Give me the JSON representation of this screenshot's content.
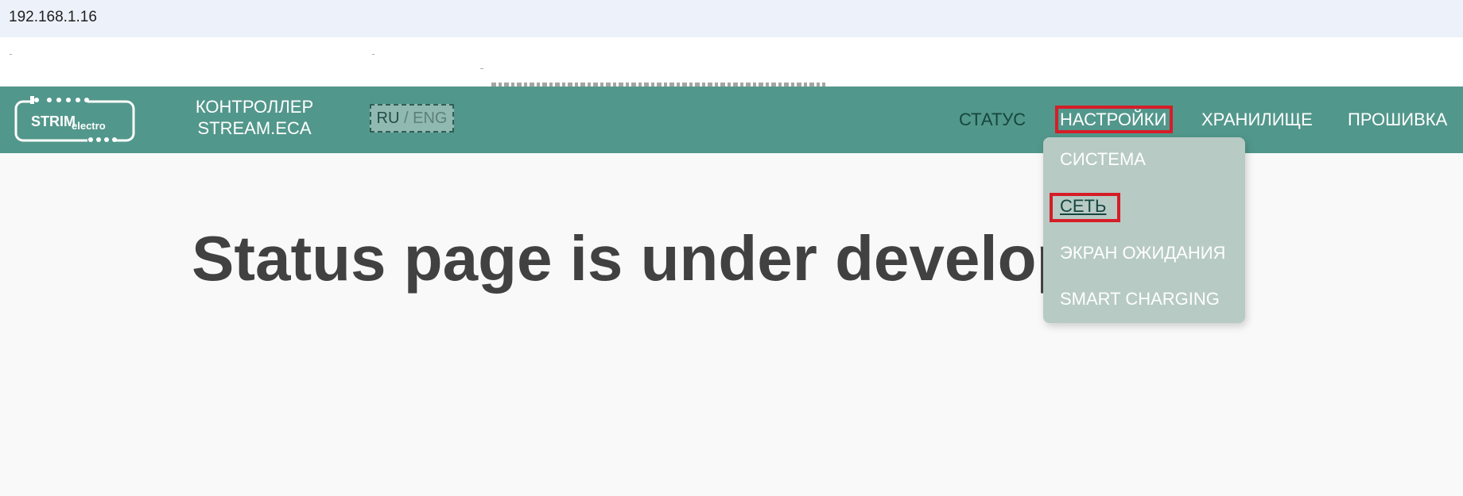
{
  "browser": {
    "address": "192.168.1.16"
  },
  "navbar": {
    "logo_text_main": "STRIM",
    "logo_text_sub": "electro",
    "brand_line1": "КОНТРОЛЛЕР",
    "brand_line2": "STREAM.ECA",
    "lang_ru": "RU",
    "lang_sep": "/",
    "lang_eng": "ENG",
    "links": {
      "status": "СТАТУС",
      "settings": "НАСТРОЙКИ",
      "storage": "ХРАНИЛИЩЕ",
      "firmware": "ПРОШИВКА"
    }
  },
  "dropdown": {
    "items": [
      "СИСТЕМА",
      "СЕТЬ",
      "ЭКРАН ОЖИДАНИЯ",
      "SMART CHARGING"
    ]
  },
  "main": {
    "heading": "Status page is under development"
  },
  "colors": {
    "navbar_bg": "#52978b",
    "dropdown_bg": "#b7cac4",
    "highlight_border": "#d51d28",
    "active_text": "#15463e",
    "heading_text": "#414141"
  }
}
